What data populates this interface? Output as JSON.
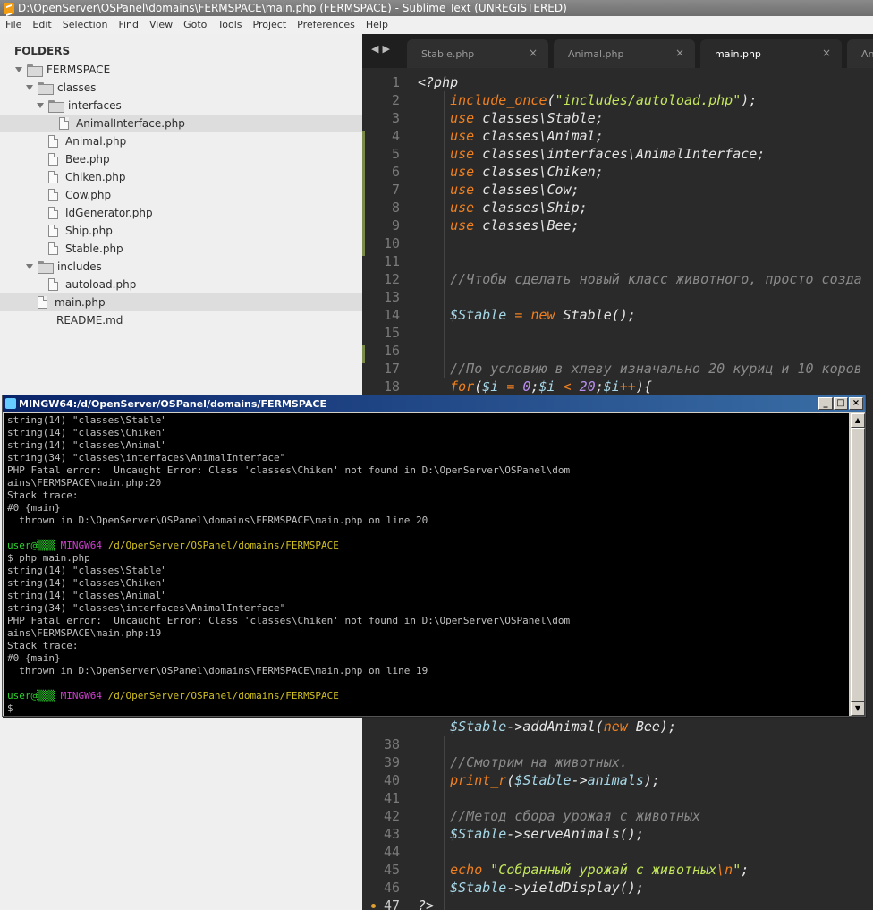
{
  "window": {
    "title": "D:\\OpenServer\\OSPanel\\domains\\FERMSPACE\\main.php (FERMSPACE) - Sublime Text (UNREGISTERED)"
  },
  "menu": [
    "File",
    "Edit",
    "Selection",
    "Find",
    "View",
    "Goto",
    "Tools",
    "Project",
    "Preferences",
    "Help"
  ],
  "sidebar": {
    "heading": "FOLDERS",
    "items": [
      {
        "label": "FERMSPACE",
        "kind": "folder"
      },
      {
        "label": "classes",
        "kind": "folder"
      },
      {
        "label": "interfaces",
        "kind": "folder"
      },
      {
        "label": "AnimalInterface.php",
        "kind": "file",
        "selected": true
      },
      {
        "label": "Animal.php",
        "kind": "file"
      },
      {
        "label": "Bee.php",
        "kind": "file"
      },
      {
        "label": "Chiken.php",
        "kind": "file"
      },
      {
        "label": "Cow.php",
        "kind": "file"
      },
      {
        "label": "IdGenerator.php",
        "kind": "file"
      },
      {
        "label": "Ship.php",
        "kind": "file"
      },
      {
        "label": "Stable.php",
        "kind": "file"
      },
      {
        "label": "includes",
        "kind": "folder"
      },
      {
        "label": "autoload.php",
        "kind": "file"
      },
      {
        "label": "main.php",
        "kind": "file",
        "selected": true
      },
      {
        "label": "README.md",
        "kind": "file-noicon"
      }
    ]
  },
  "tabs": [
    {
      "label": "Stable.php",
      "close": "×"
    },
    {
      "label": "Animal.php",
      "close": "×"
    },
    {
      "label": "main.php",
      "close": "×",
      "active": true
    },
    {
      "label": "Ani",
      "close": ""
    }
  ],
  "editor": {
    "line_numbers": [
      "1",
      "2",
      "3",
      "4",
      "5",
      "6",
      "7",
      "8",
      "9",
      "10",
      "11",
      "12",
      "13",
      "14",
      "15",
      "16",
      "17",
      "18"
    ],
    "bottom_line_numbers": [
      "38",
      "39",
      "40",
      "41",
      "42",
      "43",
      "44",
      "45",
      "46",
      "47"
    ],
    "bottom_partial_line": "$Stable->addAnimal(new Bee);"
  },
  "console": {
    "title": "MINGW64:/d/OpenServer/OSPanel/domains/FERMSPACE",
    "buttons": {
      "min": "_",
      "max": "□",
      "close": "×"
    },
    "lines": [
      "string(14) \"classes\\Stable\"",
      "string(14) \"classes\\Chiken\"",
      "string(14) \"classes\\Animal\"",
      "string(34) \"classes\\interfaces\\AnimalInterface\"",
      "PHP Fatal error:  Uncaught Error: Class 'classes\\Chiken' not found in D:\\OpenServer\\OSPanel\\dom",
      "ains\\FERMSPACE\\main.php:20",
      "Stack trace:",
      "#0 {main}",
      "  thrown in D:\\OpenServer\\OSPanel\\domains\\FERMSPACE\\main.php on line 20",
      "",
      "PROMPT",
      "$ php main.php",
      "string(14) \"classes\\Stable\"",
      "string(14) \"classes\\Chiken\"",
      "string(14) \"classes\\Animal\"",
      "string(34) \"classes\\interfaces\\AnimalInterface\"",
      "PHP Fatal error:  Uncaught Error: Class 'classes\\Chiken' not found in D:\\OpenServer\\OSPanel\\dom",
      "ains\\FERMSPACE\\main.php:19",
      "Stack trace:",
      "#0 {main}",
      "  thrown in D:\\OpenServer\\OSPanel\\domains\\FERMSPACE\\main.php on line 19",
      "",
      "PROMPT",
      "$"
    ],
    "prompt": {
      "user": "user@",
      "host_mask": "▒▒▒",
      "env": "MINGW64",
      "path": "/d/OpenServer/OSPanel/domains/FERMSPACE"
    }
  },
  "colors": {
    "keyword": "#f0801f",
    "string": "#c3e65a",
    "variable": "#a7d8e8",
    "comment": "#8a8a8a",
    "editor_bg": "#2a2a2a"
  }
}
